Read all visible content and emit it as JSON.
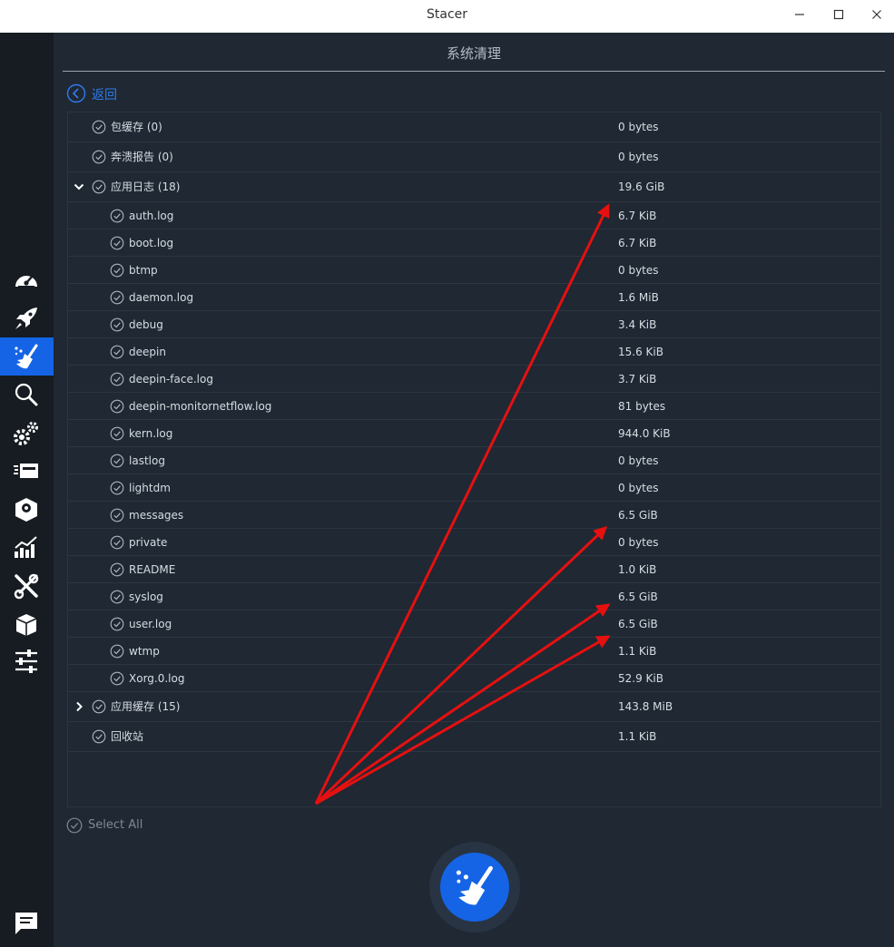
{
  "window": {
    "title": "Stacer"
  },
  "page": {
    "title": "系统清理",
    "back_label": "返回",
    "select_all": "Select All"
  },
  "tree": [
    {
      "label": "包缓存 (0)",
      "size": "0 bytes"
    },
    {
      "label": "奔溃报告 (0)",
      "size": "0 bytes"
    },
    {
      "label": "应用日志 (18)",
      "size": "19.6 GiB"
    },
    {
      "label": "auth.log",
      "size": "6.7 KiB"
    },
    {
      "label": "boot.log",
      "size": "6.7 KiB"
    },
    {
      "label": "btmp",
      "size": "0 bytes"
    },
    {
      "label": "daemon.log",
      "size": "1.6 MiB"
    },
    {
      "label": "debug",
      "size": "3.4 KiB"
    },
    {
      "label": "deepin",
      "size": "15.6 KiB"
    },
    {
      "label": "deepin-face.log",
      "size": "3.7 KiB"
    },
    {
      "label": "deepin-monitornetflow.log",
      "size": "81 bytes"
    },
    {
      "label": "kern.log",
      "size": "944.0 KiB"
    },
    {
      "label": "lastlog",
      "size": "0 bytes"
    },
    {
      "label": "lightdm",
      "size": "0 bytes"
    },
    {
      "label": "messages",
      "size": "6.5 GiB"
    },
    {
      "label": "private",
      "size": "0 bytes"
    },
    {
      "label": "README",
      "size": "1.0 KiB"
    },
    {
      "label": "syslog",
      "size": "6.5 GiB"
    },
    {
      "label": "user.log",
      "size": "6.5 GiB"
    },
    {
      "label": "wtmp",
      "size": "1.1 KiB"
    },
    {
      "label": "Xorg.0.log",
      "size": "52.9 KiB"
    },
    {
      "label": "应用缓存 (15)",
      "size": "143.8 MiB"
    },
    {
      "label": "回收站",
      "size": "1.1 KiB"
    }
  ],
  "sidebar": [
    {
      "icon": "speedometer-icon"
    },
    {
      "icon": "rocket-icon"
    },
    {
      "icon": "broom-icon",
      "active": true
    },
    {
      "icon": "magnifier-icon"
    },
    {
      "icon": "gears-icon"
    },
    {
      "icon": "services-icon"
    },
    {
      "icon": "package-icon"
    },
    {
      "icon": "chart-icon"
    },
    {
      "icon": "tools-icon"
    },
    {
      "icon": "box-icon"
    },
    {
      "icon": "sliders-icon"
    },
    {
      "icon": "feedback-icon"
    }
  ],
  "colors": {
    "accent": "#1564e6",
    "annotation": "#e61010",
    "sidebar": "#161c21",
    "panel": "#1f2833"
  }
}
